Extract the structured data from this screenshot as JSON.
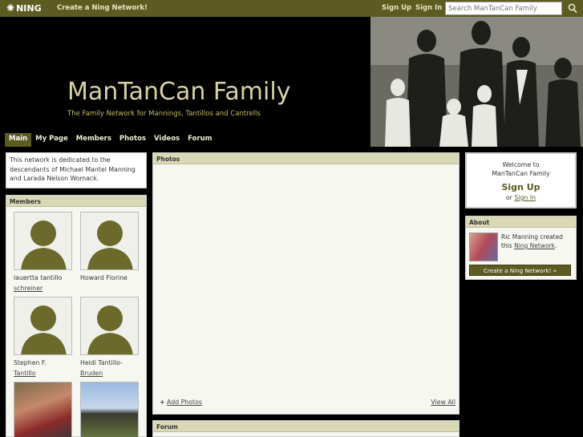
{
  "topbar": {
    "logo_text": "NING",
    "create_link": "Create a Ning Network!",
    "signup": "Sign Up",
    "signin": "Sign In",
    "search_placeholder": "Search ManTanCan Family"
  },
  "header": {
    "title": "ManTanCan Family",
    "tagline": "The Family Network for Mannings, Tantillos and Cantrells"
  },
  "nav": [
    "Main",
    "My Page",
    "Members",
    "Photos",
    "Videos",
    "Forum"
  ],
  "intro": "This network is dedicated to the descendants of Michael Mantel Manning and Larada Nelson Womack.",
  "members": {
    "title": "Members",
    "list": [
      {
        "line1": "lauertta tantillo",
        "line2": "schreiner"
      },
      {
        "line1": "Howard Florine",
        "line2": ""
      },
      {
        "line1": "Stephen F.",
        "line2": "Tantillo"
      },
      {
        "line1": "Heidi Tantillo-",
        "line2": "Bruden"
      }
    ]
  },
  "photos": {
    "title": "Photos",
    "add_label": "Add Photos",
    "add_icon": "plus-icon",
    "view_all": "View All"
  },
  "forum": {
    "title": "Forum"
  },
  "welcome": {
    "line1": "Welcome to",
    "line2": "ManTanCan Family",
    "signup": "Sign Up",
    "or": "or",
    "signin": "Sign In"
  },
  "about": {
    "title": "About",
    "creator": "Ric Manning",
    "created_text": "created this",
    "network_link": "Ning Network",
    "period": ".",
    "button": "Create a Ning Network! »"
  },
  "colors": {
    "bar": "#5c5b21",
    "title": "#d7d3a7",
    "tagline": "#c0bc6a",
    "box_head": "#d9d8b7"
  }
}
